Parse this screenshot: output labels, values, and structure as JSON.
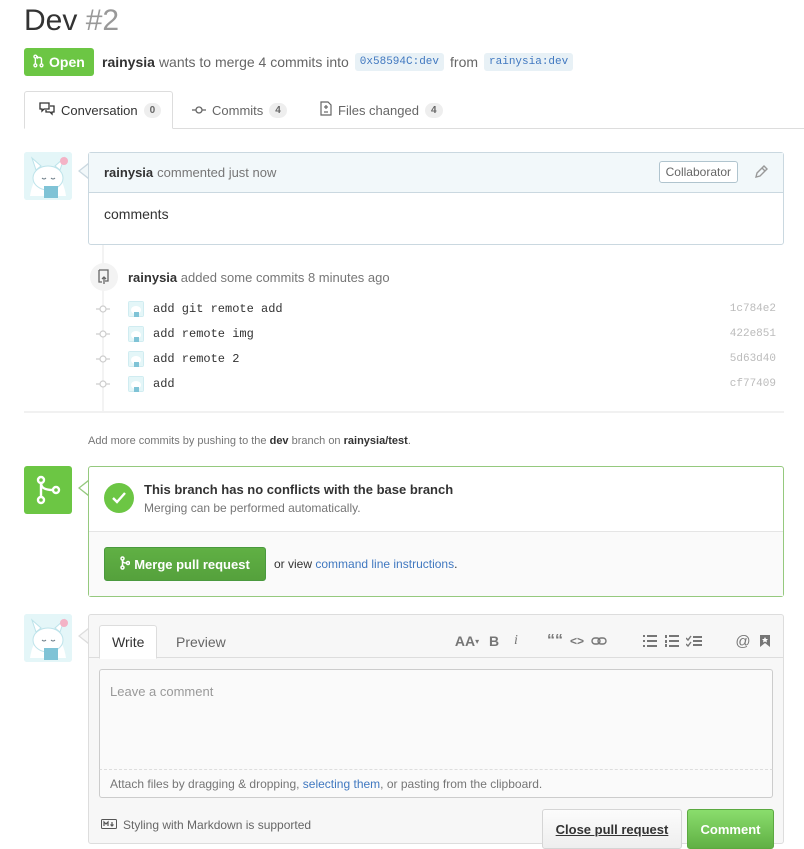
{
  "pr": {
    "title": "Dev",
    "number": "#2"
  },
  "meta": {
    "state": "Open",
    "author": "rainysia",
    "merge_text": "wants to merge 4 commits into",
    "base_branch": "0x58594C:dev",
    "from_text": "from",
    "head_branch": "rainysia:dev"
  },
  "tabs": [
    {
      "label": "Conversation",
      "count": "0",
      "icon": "comment-discussion-icon"
    },
    {
      "label": "Commits",
      "count": "4",
      "icon": "git-commit-icon"
    },
    {
      "label": "Files changed",
      "count": "4",
      "icon": "diff-icon"
    }
  ],
  "comment": {
    "author": "rainysia",
    "action": "commented just now",
    "badge": "Collaborator",
    "body": "comments"
  },
  "commits_event": {
    "author": "rainysia",
    "text": "added some commits 8 minutes ago",
    "commits": [
      {
        "message": "add git remote add",
        "sha": "1c784e2"
      },
      {
        "message": "add remote img",
        "sha": "422e851"
      },
      {
        "message": "add remote 2",
        "sha": "5d63d40"
      },
      {
        "message": "add",
        "sha": "cf77409"
      }
    ]
  },
  "push_hint": {
    "prefix": "Add more commits by pushing to the",
    "branch": "dev",
    "middle": "branch on",
    "repo": "rainysia/test",
    "suffix": "."
  },
  "merge": {
    "heading": "This branch has no conflicts with the base branch",
    "sub": "Merging can be performed automatically.",
    "button": "Merge pull request",
    "alt_prefix": "or view",
    "alt_link": "command line instructions",
    "alt_suffix": "."
  },
  "write": {
    "tab_write": "Write",
    "tab_preview": "Preview",
    "placeholder": "Leave a comment",
    "attach_prefix": "Attach files by dragging & dropping,",
    "attach_link": "selecting them",
    "attach_suffix": ", or pasting from the clipboard.",
    "markdown_note": "Styling with Markdown is supported",
    "close_button": "Close pull request",
    "comment_button": "Comment",
    "toolbar": {
      "header": "AA",
      "bold": "B",
      "italic": "i",
      "quote": "““",
      "code": "<>",
      "mention": "@"
    }
  },
  "colors": {
    "green": "#6cc644",
    "link": "#4078c0",
    "branch_bg": "#e8f1f6"
  }
}
